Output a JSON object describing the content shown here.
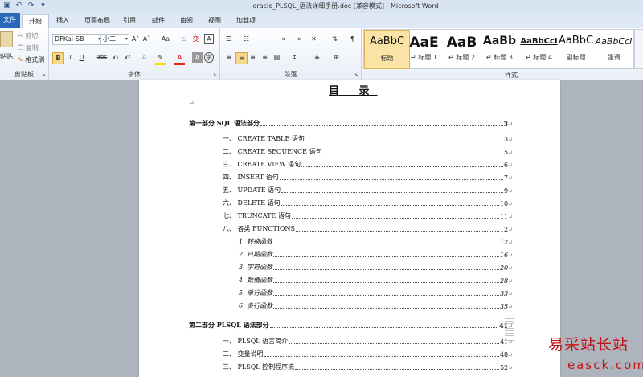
{
  "window": {
    "title": "oracle_PLSQL_语法详细手册.doc [兼容模式] - Microsoft Word"
  },
  "quick_access": [
    "save-icon",
    "undo-icon",
    "redo-icon",
    "customize-icon"
  ],
  "tabs": [
    {
      "label": "文件"
    },
    {
      "label": "开始"
    },
    {
      "label": "插入"
    },
    {
      "label": "页面布局"
    },
    {
      "label": "引用"
    },
    {
      "label": "邮件"
    },
    {
      "label": "审阅"
    },
    {
      "label": "视图"
    },
    {
      "label": "加载项"
    }
  ],
  "ribbon": {
    "clipboard": {
      "group": "剪贴板",
      "paste": "粘贴",
      "cut": "剪切",
      "copy": "复制",
      "format_painter": "格式刷"
    },
    "font": {
      "group": "字体",
      "font_name": "DFKai-SB",
      "font_size": "小二",
      "bold": "B",
      "italic": "I",
      "underline": "U",
      "strike": "abc",
      "sub": "x₂",
      "sup": "x²",
      "grow": "A˄",
      "shrink": "A˅",
      "case": "Aa",
      "char_border": "A",
      "enclose": "字"
    },
    "paragraph": {
      "group": "段落"
    },
    "styles": {
      "group": "样式",
      "items": [
        {
          "sample": "AaBbC",
          "name": "标题"
        },
        {
          "sample": "AaE",
          "name": "↵ 标题 1"
        },
        {
          "sample": "AaB",
          "name": "↵ 标题 2"
        },
        {
          "sample": "AaBb",
          "name": "↵ 标题 3"
        },
        {
          "sample": "AaBbCcI",
          "name": "↵ 标题 4"
        },
        {
          "sample": "AaBbC",
          "name": "副标题"
        },
        {
          "sample": "AaBbCcI",
          "name": "强调"
        }
      ]
    }
  },
  "document": {
    "title": "目 录",
    "paragraph_mark": "↵",
    "toc": [
      {
        "level": 1,
        "text": "第一部分   SQL 语法部分",
        "page": "3"
      },
      {
        "level": 2,
        "text": "一、 CREATE TABLE 语句",
        "page": "3"
      },
      {
        "level": 2,
        "text": "二、 CREATE SEQUENCE 语句",
        "page": "5"
      },
      {
        "level": 2,
        "text": "三、 CREATE VIEW 语句",
        "page": "6"
      },
      {
        "level": 2,
        "text": "四、 INSERT 语句",
        "page": "7"
      },
      {
        "level": 2,
        "text": "五、 UPDATE 语句",
        "page": "9"
      },
      {
        "level": 2,
        "text": "六、 DELETE 语句",
        "page": "10"
      },
      {
        "level": 2,
        "text": "七、 TRUNCATE 语句",
        "page": "11"
      },
      {
        "level": 2,
        "text": "八、 各类 FUNCTIONS",
        "page": "12"
      },
      {
        "level": 3,
        "text": "1.  转换函数",
        "page": "12"
      },
      {
        "level": 3,
        "text": "2.  日期函数",
        "page": "16"
      },
      {
        "level": 3,
        "text": "3.  字符函数",
        "page": "20"
      },
      {
        "level": 3,
        "text": "4.  数值函数",
        "page": "28"
      },
      {
        "level": 3,
        "text": "5.  单行函数",
        "page": "33"
      },
      {
        "level": 3,
        "text": "6.  多行函数",
        "page": "35"
      },
      {
        "level": 1,
        "text": "第二部分   PLSQL 语法部分",
        "page": "41"
      },
      {
        "level": 2,
        "text": "一、 PLSQL 语言简介",
        "page": "41"
      },
      {
        "level": 2,
        "text": "二、 变量说明",
        "page": "48"
      },
      {
        "level": 2,
        "text": "三、 PLSQL 控制程序流",
        "page": "52"
      }
    ]
  },
  "watermark": {
    "text": "易采站长站",
    "url": "easck.com"
  }
}
